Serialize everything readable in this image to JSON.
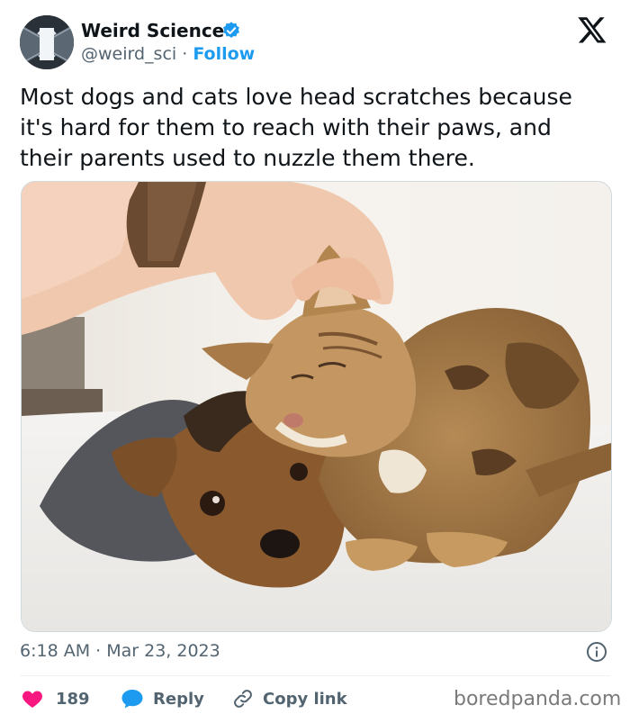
{
  "author": {
    "display_name": "Weird Science",
    "handle": "@weird_sci",
    "separator": "·",
    "follow_label": "Follow"
  },
  "tweet": {
    "text": "Most dogs and cats love head scratches because\nit's hard for them to reach with their paws, and\ntheir parents used to nuzzle them there."
  },
  "meta": {
    "timestamp": "6:18 AM · Mar 23, 2023"
  },
  "actions": {
    "like_count": "189",
    "reply_label": "Reply",
    "copy_link_label": "Copy link"
  },
  "watermark": "boredpanda.com",
  "colors": {
    "accent": "#1d9bf0",
    "like": "#f91880",
    "text": "#0f1419",
    "muted": "#536471"
  },
  "icons": [
    "x-logo-icon",
    "verified-badge-icon",
    "info-icon",
    "heart-icon",
    "reply-bubble-icon",
    "link-icon"
  ]
}
